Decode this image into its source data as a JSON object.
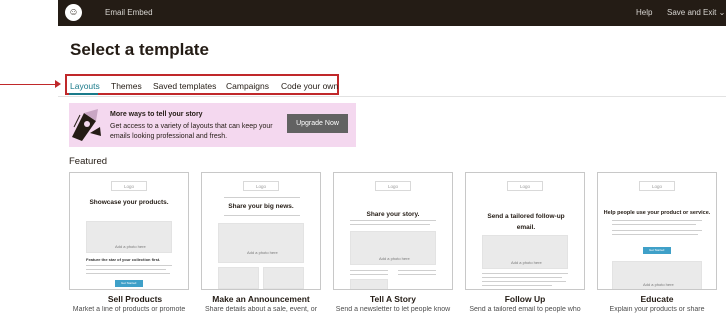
{
  "topbar": {
    "logo_glyph": "☺",
    "app_title": "Email Embed",
    "help": "Help",
    "save_exit": "Save and Exit",
    "save_exit_chevron": "⌄"
  },
  "page_title": "Select a template",
  "tabs": [
    {
      "label": "Layouts",
      "active": true
    },
    {
      "label": "Themes",
      "active": false
    },
    {
      "label": "Saved templates",
      "active": false
    },
    {
      "label": "Campaigns",
      "active": false
    },
    {
      "label": "Code your own",
      "active": false
    }
  ],
  "banner": {
    "title": "More ways to tell your story",
    "body": "Get access to a variety of layouts that can keep your emails looking professional and fresh.",
    "button": "Upgrade Now"
  },
  "featured_label": "Featured",
  "cards": [
    {
      "name": "Sell Products",
      "desc": "Market a line of products or promote",
      "logo": "Logo",
      "headline": "Showcase your products."
    },
    {
      "name": "Make an Announcement",
      "desc": "Share details about a sale, event, or",
      "logo": "Logo",
      "headline": "Share your big news."
    },
    {
      "name": "Tell A Story",
      "desc": "Send a newsletter to let people know",
      "logo": "Logo",
      "headline": "Share your story."
    },
    {
      "name": "Follow Up",
      "desc": "Send a tailored email to people who",
      "logo": "Logo",
      "headline": "Send a tailored follow-up email."
    },
    {
      "name": "Educate",
      "desc": "Explain your products or share",
      "logo": "Logo",
      "headline": "Help people use your product or service."
    }
  ],
  "mock": {
    "add_photo": "Add a photo here",
    "button_text": "Get Started",
    "feature_text": "Feature the star of your collection first."
  },
  "colors": {
    "topbar": "#241c15",
    "accent": "#1a7a8a",
    "annotation": "#c0282a",
    "banner_bg": "#f4d8ef",
    "button_gray": "#626262",
    "mock_button": "#3fa0c8"
  }
}
